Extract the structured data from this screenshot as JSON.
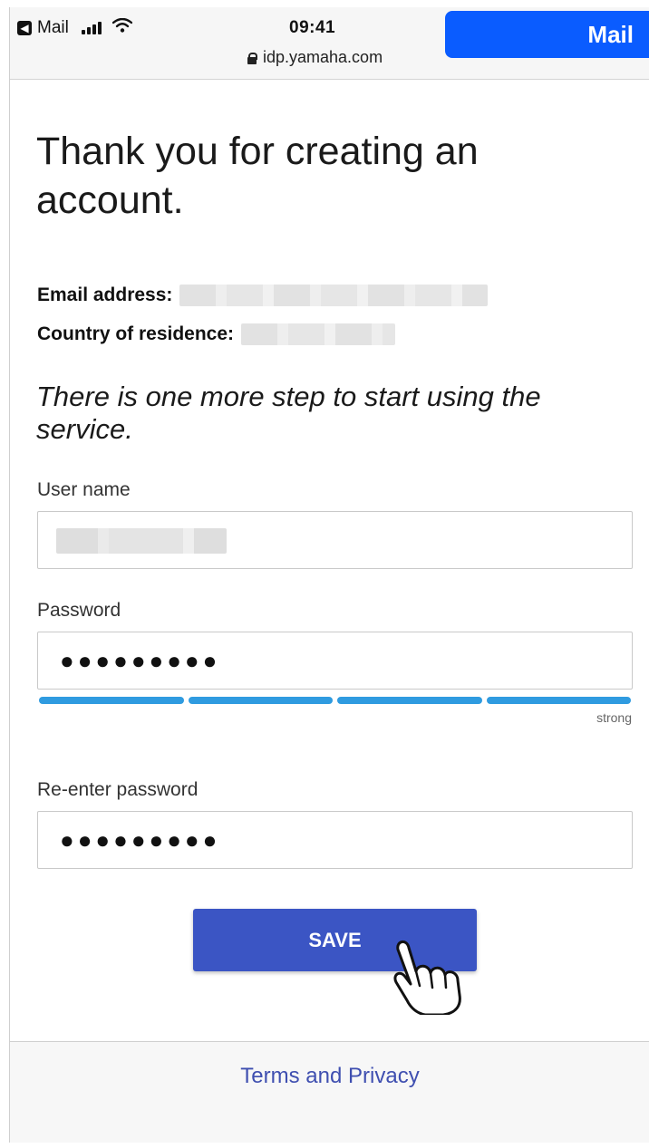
{
  "status_bar": {
    "back_app_label": "Mail",
    "time": "09:41",
    "url": "idp.yamaha.com",
    "mail_button_label": "Mail"
  },
  "main": {
    "title": "Thank you for creating an account.",
    "email_label": "Email address:",
    "country_label": "Country of residence:",
    "step_text": "There is one more step to start using the service.",
    "username_label": "User name",
    "password_label": "Password",
    "password_value": "●●●●●●●●●",
    "strength_label": "strong",
    "strength_level": 1.0,
    "reenter_label": "Re-enter password",
    "reenter_value": "●●●●●●●●●",
    "save_label": "SAVE"
  },
  "footer": {
    "terms_link": "Terms and Privacy"
  },
  "colors": {
    "accent_blue": "#0a5cff",
    "save_button": "#3b55c4",
    "strength_bar": "#2f9be0",
    "link": "#3f4fb0"
  },
  "icons": {
    "back": "back-arrow-icon",
    "signal": "cellular-signal-icon",
    "wifi": "wifi-icon",
    "lock": "lock-icon",
    "cursor": "hand-pointer-icon"
  }
}
